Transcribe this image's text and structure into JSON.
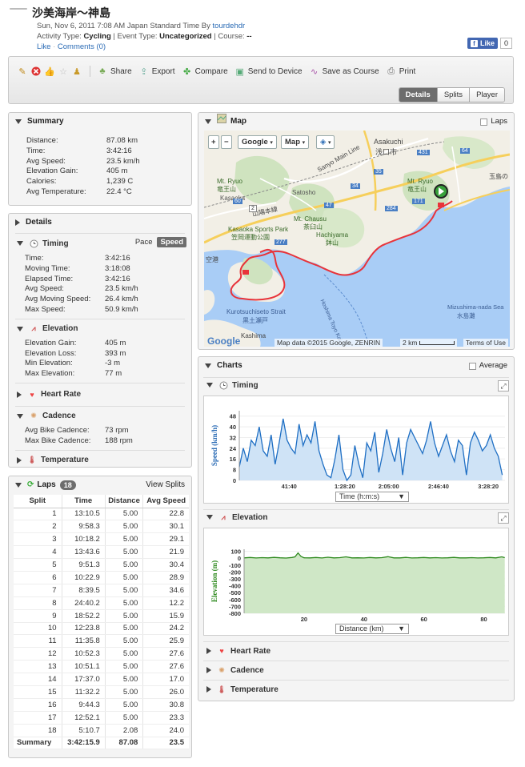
{
  "activity": {
    "title": "沙美海岸～神島",
    "date_line": "Sun, Nov 6, 2011 7:08 AM Japan Standard Time By",
    "author": "tourdehdr",
    "type_label": "Activity Type:",
    "type_value": "Cycling",
    "event_label": "Event Type:",
    "event_value": "Uncategorized",
    "course_label": "Course:",
    "course_value": "--",
    "like_link": "Like",
    "comments_link": "Comments (0)",
    "fb_like": "Like",
    "fb_count": "0"
  },
  "toolbar": {
    "actions": [
      {
        "label": "Share",
        "icon": "share-icon"
      },
      {
        "label": "Export",
        "icon": "export-icon"
      },
      {
        "label": "Compare",
        "icon": "compare-icon"
      },
      {
        "label": "Send to Device",
        "icon": "send-device-icon"
      },
      {
        "label": "Save as Course",
        "icon": "save-course-icon"
      },
      {
        "label": "Print",
        "icon": "print-icon"
      }
    ],
    "view_tabs": [
      "Details",
      "Splits",
      "Player"
    ],
    "active_view": "Details"
  },
  "summary": {
    "title": "Summary",
    "rows": [
      {
        "k": "Distance:",
        "v": "87.08 km"
      },
      {
        "k": "Time:",
        "v": "3:42:16"
      },
      {
        "k": "Avg Speed:",
        "v": "23.5 km/h"
      },
      {
        "k": "Elevation Gain:",
        "v": "405 m"
      },
      {
        "k": "Calories:",
        "v": "1,239 C"
      },
      {
        "k": "Avg Temperature:",
        "v": "22.4 °C"
      }
    ]
  },
  "details": {
    "title": "Details",
    "timing": {
      "title": "Timing",
      "pace": "Pace",
      "speed": "Speed",
      "rows": [
        {
          "k": "Time:",
          "v": "3:42:16"
        },
        {
          "k": "Moving Time:",
          "v": "3:18:08"
        },
        {
          "k": "Elapsed Time:",
          "v": "3:42:16"
        },
        {
          "k": "Avg Speed:",
          "v": "23.5 km/h"
        },
        {
          "k": "Avg Moving Speed:",
          "v": "26.4 km/h"
        },
        {
          "k": "Max Speed:",
          "v": "50.9 km/h"
        }
      ]
    },
    "elevation": {
      "title": "Elevation",
      "rows": [
        {
          "k": "Elevation Gain:",
          "v": "405 m"
        },
        {
          "k": "Elevation Loss:",
          "v": "393 m"
        },
        {
          "k": "Min Elevation:",
          "v": "-3 m"
        },
        {
          "k": "Max Elevation:",
          "v": "77 m"
        }
      ]
    },
    "heart_rate": {
      "title": "Heart Rate"
    },
    "cadence": {
      "title": "Cadence",
      "rows": [
        {
          "k": "Avg Bike Cadence:",
          "v": "73 rpm"
        },
        {
          "k": "Max Bike Cadence:",
          "v": "188 rpm"
        }
      ]
    },
    "temperature": {
      "title": "Temperature"
    }
  },
  "laps": {
    "title": "Laps",
    "count": "18",
    "view_splits": "View Splits",
    "columns": [
      "Split",
      "Time",
      "Distance",
      "Avg Speed"
    ],
    "rows": [
      [
        "1",
        "13:10.5",
        "5.00",
        "22.8"
      ],
      [
        "2",
        "9:58.3",
        "5.00",
        "30.1"
      ],
      [
        "3",
        "10:18.2",
        "5.00",
        "29.1"
      ],
      [
        "4",
        "13:43.6",
        "5.00",
        "21.9"
      ],
      [
        "5",
        "9:51.3",
        "5.00",
        "30.4"
      ],
      [
        "6",
        "10:22.9",
        "5.00",
        "28.9"
      ],
      [
        "7",
        "8:39.5",
        "5.00",
        "34.6"
      ],
      [
        "8",
        "24:40.2",
        "5.00",
        "12.2"
      ],
      [
        "9",
        "18:52.2",
        "5.00",
        "15.9"
      ],
      [
        "10",
        "12:23.8",
        "5.00",
        "24.2"
      ],
      [
        "11",
        "11:35.8",
        "5.00",
        "25.9"
      ],
      [
        "12",
        "10:52.3",
        "5.00",
        "27.6"
      ],
      [
        "13",
        "10:51.1",
        "5.00",
        "27.6"
      ],
      [
        "14",
        "17:37.0",
        "5.00",
        "17.0"
      ],
      [
        "15",
        "11:32.2",
        "5.00",
        "26.0"
      ],
      [
        "16",
        "9:44.3",
        "5.00",
        "30.8"
      ],
      [
        "17",
        "12:52.1",
        "5.00",
        "23.3"
      ],
      [
        "18",
        "5:10.7",
        "2.08",
        "24.0"
      ]
    ],
    "summary": [
      "Summary",
      "3:42:15.9",
      "87.08",
      "23.5"
    ]
  },
  "map": {
    "title": "Map",
    "laps_toggle": "Laps",
    "zoom_in": "+",
    "zoom_out": "−",
    "provider": "Google",
    "map_type": "Map",
    "attribution": "Map data ©2015 Google, ZENRIN",
    "scale": "2 km",
    "terms": "Terms of Use",
    "google_logo": "Google",
    "labels": {
      "asakuchi": "Asakuchi",
      "asakuchi_jp": "浅口市",
      "satosho": "Satosho",
      "kasaoka": "Kasaoka",
      "mt_ryuo": "Mt. Ryuo",
      "ryuozan": "竜王山",
      "mt_ryuo2": "Mt. Ryuo",
      "ryuozan2": "竜王山",
      "sanyo": "Sanyo Main Line",
      "sanyo_hon": "山陽本線",
      "mt_chausu": "Mt. Chausu",
      "chausu_jp": "茶臼山",
      "hachiyama": "Hachiyama",
      "hachi_jp": "鉢山",
      "park": "Kasaoka Sports Park",
      "park_jp": "笠岡運動公園",
      "kurotsuchiseto": "Kurotsuchiseto Strait",
      "kurotsuchiseto_jp": "黒土瀬戸",
      "mizushima": "Mizushima-nada Sea",
      "mizushima_jp": "水島灘",
      "kashima": "Kashima",
      "kashima_jp": "島",
      "tamashima": "玉島の",
      "kuba": "空港",
      "fishing": "Hoshima Toyo Kai",
      "route_2": "2",
      "route_431": "431",
      "route_47": "47",
      "route_34": "34",
      "route_171": "171",
      "route_64": "64",
      "route_60": "60",
      "route_284": "284",
      "route_35": "35",
      "route_277": "277"
    }
  },
  "charts": {
    "title": "Charts",
    "average_toggle": "Average",
    "timing": {
      "title": "Timing",
      "axis_select": "Time (h:m:s)"
    },
    "elevation": {
      "title": "Elevation",
      "axis_select": "Distance (km)"
    },
    "heart_rate": {
      "title": "Heart Rate"
    },
    "cadence": {
      "title": "Cadence"
    },
    "temperature": {
      "title": "Temperature"
    }
  },
  "chart_data": [
    {
      "type": "area",
      "title": "",
      "xlabel": "Time (h:m:s)",
      "ylabel": "Speed (km/h)",
      "x_ticks": [
        "41:40",
        "1:28:20",
        "2:05:00",
        "2:46:40",
        "3:28:20"
      ],
      "x_tick_values": [
        2500,
        5300,
        7500,
        10000,
        12500
      ],
      "xlim": [
        0,
        13336
      ],
      "y_ticks": [
        0,
        8,
        16,
        24,
        32,
        40,
        48
      ],
      "ylim": [
        0,
        52
      ],
      "series": [
        {
          "x": [
            0,
            200,
            400,
            600,
            800,
            1000,
            1200,
            1400,
            1600,
            1800,
            2000,
            2200,
            2400,
            2600,
            2800,
            3000,
            3200,
            3400,
            3600,
            3800,
            4000,
            4200,
            4400,
            4600,
            4800,
            5000,
            5200,
            5400,
            5600,
            5800,
            6000,
            6200,
            6400,
            6600,
            6800,
            7000,
            7200,
            7400,
            7600,
            7800,
            8000,
            8200,
            8400,
            8600,
            8800,
            9000,
            9200,
            9400,
            9600,
            9800,
            10000,
            10200,
            10400,
            10600,
            10800,
            11000,
            11200,
            11400,
            11600,
            11800,
            12000,
            12200,
            12400,
            12600,
            12800,
            13000,
            13200
          ],
          "values": [
            10,
            24,
            14,
            30,
            26,
            40,
            22,
            18,
            34,
            12,
            28,
            46,
            30,
            24,
            20,
            42,
            26,
            34,
            28,
            44,
            22,
            12,
            4,
            2,
            16,
            34,
            8,
            0,
            4,
            26,
            12,
            2,
            28,
            22,
            36,
            6,
            20,
            38,
            24,
            14,
            32,
            4,
            28,
            38,
            32,
            26,
            20,
            30,
            44,
            28,
            18,
            26,
            34,
            22,
            14,
            30,
            26,
            4,
            28,
            36,
            30,
            22,
            26,
            34,
            24,
            18,
            4
          ]
        }
      ]
    },
    {
      "type": "area",
      "title": "",
      "xlabel": "Distance (km)",
      "ylabel": "Elevation (m)",
      "x_ticks": [
        20,
        40,
        60,
        80
      ],
      "xlim": [
        0,
        87.08
      ],
      "y_ticks": [
        100,
        0,
        -100,
        -200,
        -300,
        -400,
        -500,
        -600,
        -700,
        -800
      ],
      "ylim": [
        -800,
        130
      ],
      "series": [
        {
          "x": [
            0,
            2,
            4,
            6,
            8,
            10,
            12,
            14,
            16,
            17,
            18,
            19,
            20,
            22,
            24,
            26,
            28,
            30,
            32,
            34,
            36,
            38,
            40,
            42,
            44,
            46,
            48,
            50,
            52,
            54,
            56,
            58,
            60,
            62,
            64,
            66,
            68,
            70,
            72,
            74,
            76,
            78,
            80,
            82,
            84,
            86,
            87
          ],
          "values": [
            5,
            10,
            3,
            8,
            4,
            12,
            6,
            2,
            10,
            20,
            77,
            25,
            6,
            4,
            10,
            3,
            14,
            4,
            8,
            20,
            4,
            6,
            3,
            10,
            5,
            8,
            22,
            5,
            4,
            12,
            3,
            6,
            10,
            4,
            8,
            3,
            6,
            12,
            4,
            5,
            8,
            3,
            6,
            10,
            4,
            20,
            8
          ]
        }
      ]
    }
  ],
  "colors": {
    "speed_line": "#1f6fc4",
    "speed_fill": "#cfe3f6",
    "elev_line": "#2f8a1f",
    "elev_fill": "#cfe7c6",
    "route": "#e8333a",
    "active_tab": "#6d6d6d"
  }
}
